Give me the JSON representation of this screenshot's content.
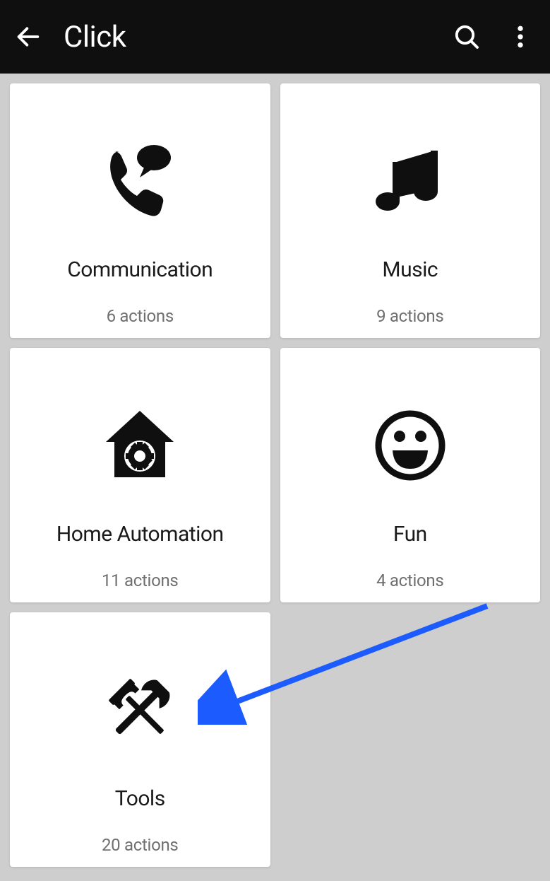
{
  "header": {
    "title": "Click"
  },
  "cards": [
    {
      "icon": "phone-chat-icon",
      "title": "Communication",
      "sub": "6 actions"
    },
    {
      "icon": "music-note-icon",
      "title": "Music",
      "sub": "9 actions"
    },
    {
      "icon": "home-gear-icon",
      "title": "Home Automation",
      "sub": "11 actions"
    },
    {
      "icon": "smile-icon",
      "title": "Fun",
      "sub": "4 actions"
    },
    {
      "icon": "tools-icon",
      "title": "Tools",
      "sub": "20 actions"
    }
  ],
  "annotation": {
    "arrow_color": "#1c5cff"
  }
}
